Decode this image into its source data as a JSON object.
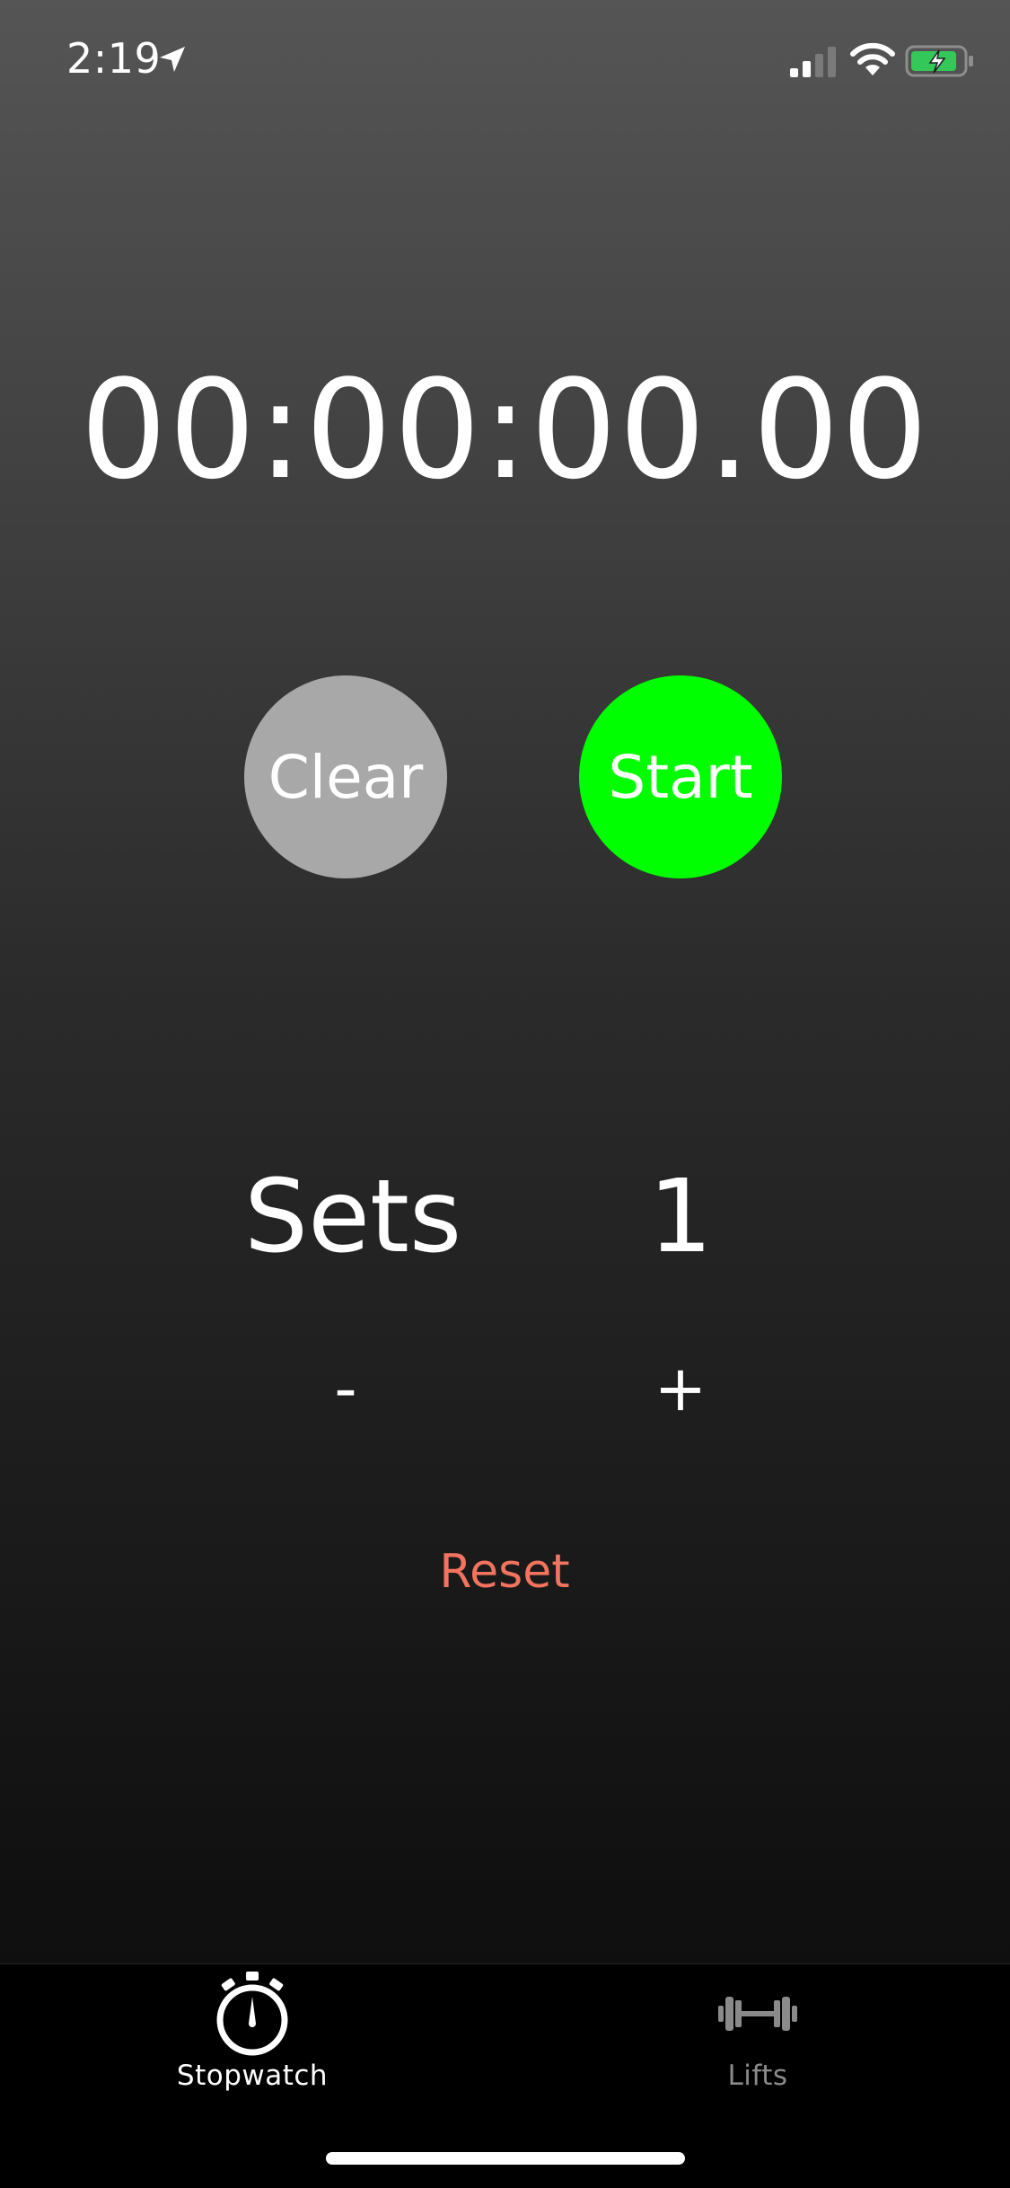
{
  "status_bar": {
    "time": "2:19",
    "icons": [
      "location-arrow-icon",
      "cellular-signal-icon",
      "wifi-icon",
      "battery-charging-icon"
    ]
  },
  "timer": {
    "display": "00:00:00.00"
  },
  "buttons": {
    "clear_label": "Clear",
    "start_label": "Start",
    "clear_color": "#a8a8a8",
    "start_color": "#00ff00"
  },
  "sets": {
    "label": "Sets",
    "value": "1",
    "decrement_label": "-",
    "increment_label": "+",
    "reset_label": "Reset",
    "reset_color": "#f2735e"
  },
  "tab_bar": {
    "items": [
      {
        "label": "Stopwatch",
        "icon": "stopwatch-icon",
        "selected": true
      },
      {
        "label": "Lifts",
        "icon": "dumbbell-icon",
        "selected": false
      }
    ]
  }
}
